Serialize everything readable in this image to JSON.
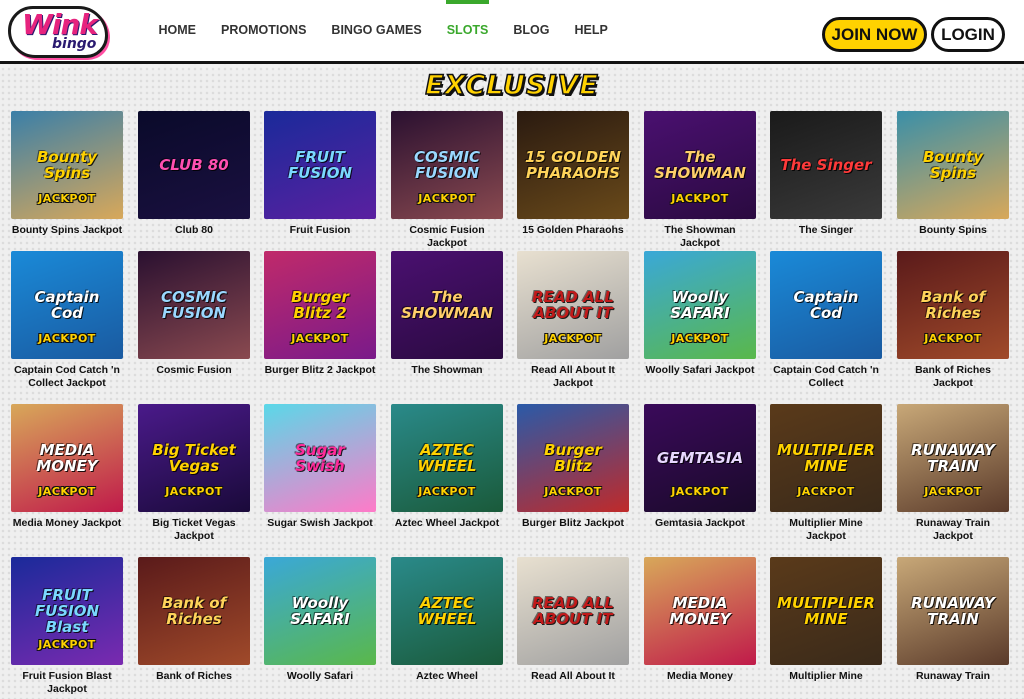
{
  "brand": {
    "logo_top": "Wink",
    "logo_bottom": "bingo"
  },
  "nav": [
    {
      "label": "HOME",
      "active": false
    },
    {
      "label": "PROMOTIONS",
      "active": false
    },
    {
      "label": "BINGO GAMES",
      "active": false
    },
    {
      "label": "SLOTS",
      "active": true
    },
    {
      "label": "BLOG",
      "active": false
    },
    {
      "label": "HELP",
      "active": false
    }
  ],
  "buttons": {
    "join": "JOIN NOW",
    "login": "LOGIN"
  },
  "section": {
    "title": "EXCLUSIVE"
  },
  "games": [
    {
      "title": "Bounty Spins Jackpot",
      "art": "Bounty Spins",
      "jackpot": true,
      "bg": "#3a7fa8",
      "bg2": "#d8a85a",
      "fg": "#ffd200"
    },
    {
      "title": "Club 80",
      "art": "CLUB 80",
      "jackpot": false,
      "bg": "#0a0a2a",
      "bg2": "#1a1040",
      "fg": "#ff4fb0"
    },
    {
      "title": "Fruit Fusion",
      "art": "FRUIT FUSION",
      "jackpot": false,
      "bg": "#1a2a9a",
      "bg2": "#5a20a0",
      "fg": "#7ad8ff"
    },
    {
      "title": "Cosmic Fusion Jackpot",
      "art": "COSMIC FUSION",
      "jackpot": true,
      "bg": "#2a1030",
      "bg2": "#8a4a50",
      "fg": "#9ad8ff"
    },
    {
      "title": "15 Golden Pharaohs",
      "art": "15 GOLDEN PHARAOHS",
      "jackpot": false,
      "bg": "#2a1a10",
      "bg2": "#6a4a1a",
      "fg": "#ffd45a"
    },
    {
      "title": "The Showman Jackpot",
      "art": "The SHOWMAN",
      "jackpot": true,
      "bg": "#4a1070",
      "bg2": "#2a0a40",
      "fg": "#ffcf6a"
    },
    {
      "title": "The Singer",
      "art": "The Singer",
      "jackpot": false,
      "bg": "#1a1a1a",
      "bg2": "#3a3a3a",
      "fg": "#ff3a3a"
    },
    {
      "title": "Bounty Spins",
      "art": "Bounty Spins",
      "jackpot": false,
      "bg": "#3a8fa8",
      "bg2": "#d8a85a",
      "fg": "#ffd200"
    },
    {
      "title": "Captain Cod Catch 'n Collect Jackpot",
      "art": "Captain Cod",
      "jackpot": true,
      "bg": "#1a8ad8",
      "bg2": "#1a5aa0",
      "fg": "#ffffff"
    },
    {
      "title": "Cosmic Fusion",
      "art": "COSMIC FUSION",
      "jackpot": false,
      "bg": "#2a1030",
      "bg2": "#8a4a50",
      "fg": "#9ad8ff"
    },
    {
      "title": "Burger Blitz 2 Jackpot",
      "art": "Burger Blitz 2",
      "jackpot": true,
      "bg": "#c02a6a",
      "bg2": "#7a1a8a",
      "fg": "#ffd200"
    },
    {
      "title": "The Showman",
      "art": "The SHOWMAN",
      "jackpot": false,
      "bg": "#4a1070",
      "bg2": "#2a0a40",
      "fg": "#ffcf6a"
    },
    {
      "title": "Read All About It Jackpot",
      "art": "READ ALL ABOUT IT",
      "jackpot": true,
      "bg": "#e8e0d0",
      "bg2": "#a0a0a0",
      "fg": "#c01a1a"
    },
    {
      "title": "Woolly Safari Jackpot",
      "art": "Woolly SAFARI",
      "jackpot": true,
      "bg": "#3aa8d8",
      "bg2": "#5ab84a",
      "fg": "#ffffff"
    },
    {
      "title": "Captain Cod Catch 'n Collect",
      "art": "Captain Cod",
      "jackpot": false,
      "bg": "#1a8ad8",
      "bg2": "#1a5aa0",
      "fg": "#ffffff"
    },
    {
      "title": "Bank of Riches Jackpot",
      "art": "Bank of Riches",
      "jackpot": true,
      "bg": "#5a1a1a",
      "bg2": "#a04a2a",
      "fg": "#ffd45a"
    },
    {
      "title": "Media Money Jackpot",
      "art": "MEDIA MONEY",
      "jackpot": true,
      "bg": "#d8a85a",
      "bg2": "#c01a4a",
      "fg": "#ffffff"
    },
    {
      "title": "Big Ticket Vegas Jackpot",
      "art": "Big Ticket Vegas",
      "jackpot": true,
      "bg": "#4a1a8a",
      "bg2": "#1a0a3a",
      "fg": "#ffd200"
    },
    {
      "title": "Sugar Swish Jackpot",
      "art": "Sugar Swish",
      "jackpot": false,
      "bg": "#5ad8e8",
      "bg2": "#ff7ac8",
      "fg": "#ff2a9a"
    },
    {
      "title": "Aztec Wheel Jackpot",
      "art": "AZTEC WHEEL",
      "jackpot": true,
      "bg": "#2a8a8a",
      "bg2": "#1a5a3a",
      "fg": "#ffd200"
    },
    {
      "title": "Burger Blitz Jackpot",
      "art": "Burger Blitz",
      "jackpot": true,
      "bg": "#2a5aa8",
      "bg2": "#c02a2a",
      "fg": "#ffd200"
    },
    {
      "title": "Gemtasia Jackpot",
      "art": "GEMTASIA",
      "jackpot": true,
      "bg": "#3a0a5a",
      "bg2": "#1a0a2a",
      "fg": "#e8d8ff"
    },
    {
      "title": "Multiplier Mine Jackpot",
      "art": "MULTIPLIER MINE",
      "jackpot": true,
      "bg": "#5a3a1a",
      "bg2": "#3a2a1a",
      "fg": "#ffd200"
    },
    {
      "title": "Runaway Train Jackpot",
      "art": "RUNAWAY TRAIN",
      "jackpot": true,
      "bg": "#c8a878",
      "bg2": "#5a3a2a",
      "fg": "#ffffff"
    },
    {
      "title": "Fruit Fusion Blast Jackpot",
      "art": "FRUIT FUSION Blast",
      "jackpot": true,
      "bg": "#1a2a9a",
      "bg2": "#7a2ab0",
      "fg": "#7ad8ff"
    },
    {
      "title": "Bank of Riches",
      "art": "Bank of Riches",
      "jackpot": false,
      "bg": "#5a1a1a",
      "bg2": "#a04a2a",
      "fg": "#ffd45a"
    },
    {
      "title": "Woolly Safari",
      "art": "Woolly SAFARI",
      "jackpot": false,
      "bg": "#3aa8d8",
      "bg2": "#5ab84a",
      "fg": "#ffffff"
    },
    {
      "title": "Aztec Wheel",
      "art": "AZTEC WHEEL",
      "jackpot": false,
      "bg": "#2a8a8a",
      "bg2": "#1a5a3a",
      "fg": "#ffd200"
    },
    {
      "title": "Read All About It",
      "art": "READ ALL ABOUT IT",
      "jackpot": false,
      "bg": "#e8e0d0",
      "bg2": "#a0a0a0",
      "fg": "#c01a1a"
    },
    {
      "title": "Media Money",
      "art": "MEDIA MONEY",
      "jackpot": false,
      "bg": "#d8a85a",
      "bg2": "#c01a4a",
      "fg": "#ffffff"
    },
    {
      "title": "Multiplier Mine",
      "art": "MULTIPLIER MINE",
      "jackpot": false,
      "bg": "#5a3a1a",
      "bg2": "#3a2a1a",
      "fg": "#ffd200"
    },
    {
      "title": "Runaway Train",
      "art": "RUNAWAY TRAIN",
      "jackpot": false,
      "bg": "#c8a878",
      "bg2": "#5a3a2a",
      "fg": "#ffffff"
    }
  ],
  "jackpot_label": "JACKPOT"
}
